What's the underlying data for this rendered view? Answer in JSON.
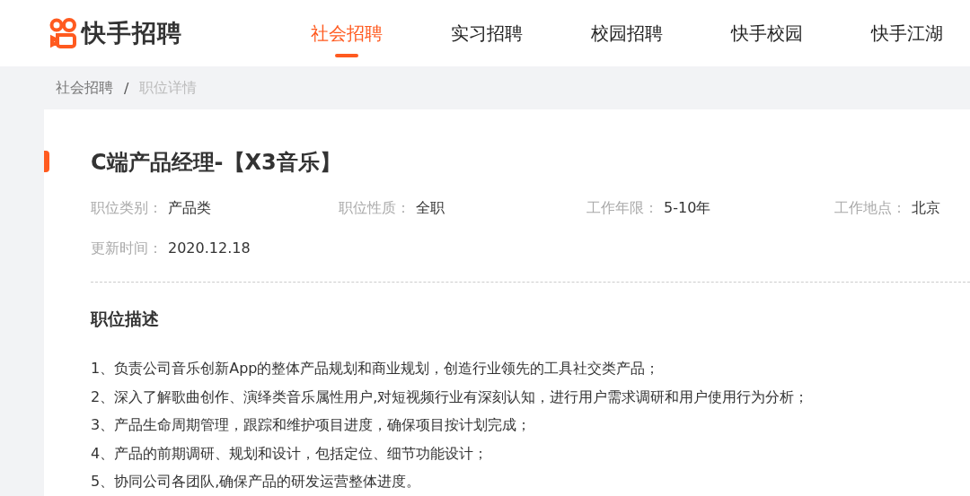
{
  "header": {
    "logo_text": "快手招聘",
    "nav": [
      {
        "label": "社会招聘",
        "selected": true
      },
      {
        "label": "实习招聘",
        "selected": false
      },
      {
        "label": "校园招聘",
        "selected": false
      },
      {
        "label": "快手校园",
        "selected": false
      },
      {
        "label": "快手江湖",
        "selected": false
      }
    ]
  },
  "breadcrumb": {
    "items": [
      "社会招聘",
      "职位详情"
    ],
    "separator": "/"
  },
  "job": {
    "title": "C端产品经理-【X3音乐】",
    "meta": [
      {
        "label": "职位类别：",
        "value": "产品类"
      },
      {
        "label": "职位性质：",
        "value": "全职"
      },
      {
        "label": "工作年限：",
        "value": "5-10年"
      },
      {
        "label": "工作地点：",
        "value": "北京"
      }
    ],
    "updated": {
      "label": "更新时间：",
      "value": "2020.12.18"
    },
    "description": {
      "heading": "职位描述",
      "lines": [
        "1、负责公司音乐创新App的整体产品规划和商业规划，创造行业领先的工具社交类产品；",
        "2、深入了解歌曲创作、演绎类音乐属性用户,对短视频行业有深刻认知，进行用户需求调研和用户使用行为分析；",
        "3、产品生命周期管理，跟踪和维护项目进度，确保项目按计划完成；",
        "4、产品的前期调研、规划和设计，包括定位、细节功能设计；",
        "5、协同公司各团队,确保产品的研发运营整体进度。"
      ]
    }
  }
}
